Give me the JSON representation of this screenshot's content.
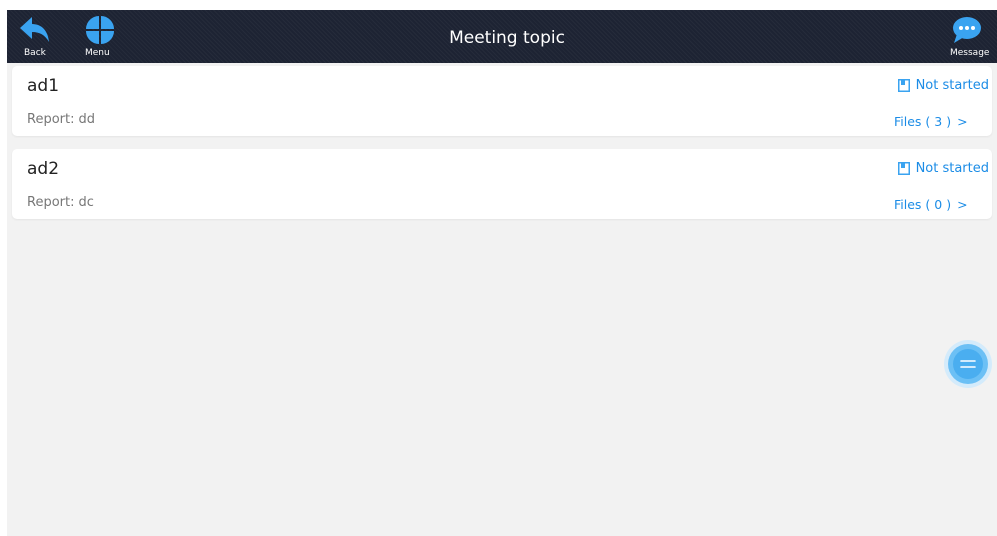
{
  "header": {
    "title": "Meeting topic",
    "back_label": "Back",
    "menu_label": "Menu",
    "message_label": "Message"
  },
  "topics": [
    {
      "title": "ad1",
      "report_label": "Report:",
      "report_value": "dd",
      "status": "Not started",
      "files_label": "Files",
      "files_count": "( 3 )",
      "files_chevron": ">"
    },
    {
      "title": "ad2",
      "report_label": "Report:",
      "report_value": "dc",
      "status": "Not started",
      "files_label": "Files",
      "files_count": "( 0 )",
      "files_chevron": ">"
    }
  ],
  "icons": {
    "back": "back-arrow-icon",
    "menu": "four-petal-menu-icon",
    "message": "chat-bubble-icon",
    "status": "document-icon",
    "floating": "floating-menu-icon"
  },
  "colors": {
    "topbar_bg": "#1d2333",
    "accent_blue": "#1b8ce6",
    "icon_blue": "#3aa3f0",
    "page_bg": "#f2f2f2",
    "card_bg": "#ffffff",
    "title_text": "#222222",
    "muted_text": "#777777"
  }
}
